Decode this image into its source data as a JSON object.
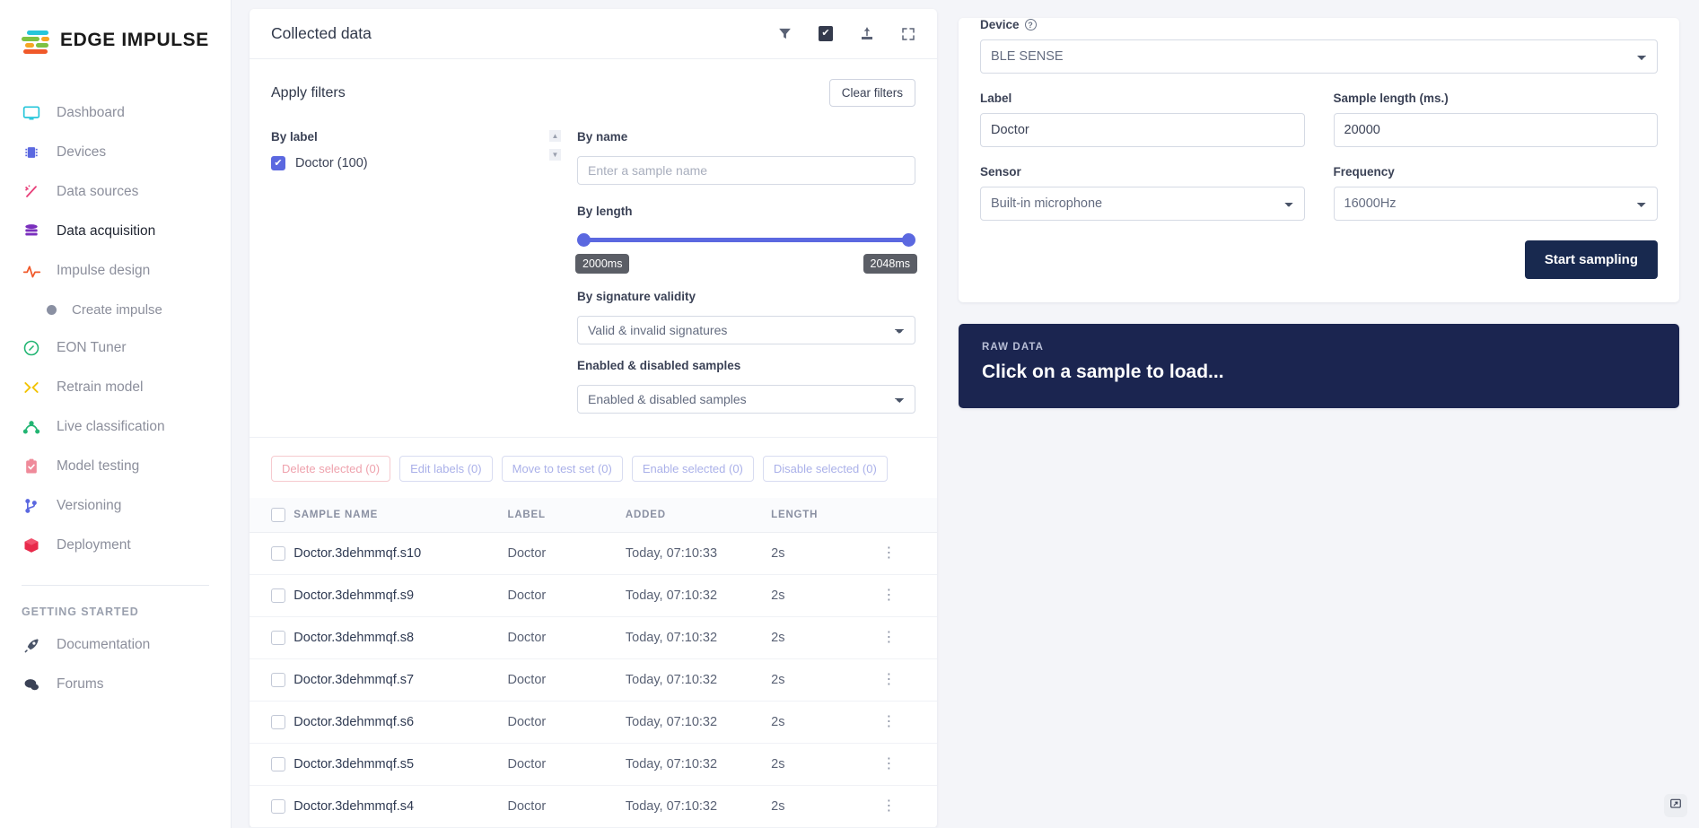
{
  "brand": {
    "name": "EDGE IMPULSE"
  },
  "sidebar": {
    "items": [
      {
        "label": "Dashboard",
        "icon": "monitor-icon"
      },
      {
        "label": "Devices",
        "icon": "chip-icon"
      },
      {
        "label": "Data sources",
        "icon": "wand-icon"
      },
      {
        "label": "Data acquisition",
        "icon": "database-icon"
      },
      {
        "label": "Impulse design",
        "icon": "pulse-icon"
      }
    ],
    "sub_item": {
      "label": "Create impulse",
      "icon": "dot-icon"
    },
    "items2": [
      {
        "label": "EON Tuner",
        "icon": "compass-icon"
      },
      {
        "label": "Retrain model",
        "icon": "shuffle-icon"
      },
      {
        "label": "Live classification",
        "icon": "graph-icon"
      },
      {
        "label": "Model testing",
        "icon": "clipboard-check-icon"
      },
      {
        "label": "Versioning",
        "icon": "branch-icon"
      },
      {
        "label": "Deployment",
        "icon": "box-icon"
      }
    ],
    "getting_started_header": "GETTING STARTED",
    "getting_started": [
      {
        "label": "Documentation",
        "icon": "rocket-icon"
      },
      {
        "label": "Forums",
        "icon": "chat-icon"
      }
    ]
  },
  "collected": {
    "title": "Collected data",
    "icons": [
      "filter-icon",
      "checkbox-checked-icon",
      "upload-icon",
      "expand-icon"
    ],
    "filters": {
      "title": "Apply filters",
      "clear_label": "Clear filters",
      "by_label_title": "By label",
      "label_option": "Doctor (100)",
      "label_checked": true,
      "by_name_title": "By name",
      "name_placeholder": "Enter a sample name",
      "name_value": "",
      "by_length_title": "By length",
      "length_min": "2000ms",
      "length_max": "2048ms",
      "signature_title": "By signature validity",
      "signature_value": "Valid & invalid signatures",
      "enabled_title": "Enabled & disabled samples",
      "enabled_value": "Enabled & disabled samples"
    },
    "actions": [
      {
        "label": "Delete selected (0)",
        "style": "danger"
      },
      {
        "label": "Edit labels (0)",
        "style": "normal"
      },
      {
        "label": "Move to test set (0)",
        "style": "normal"
      },
      {
        "label": "Enable selected (0)",
        "style": "normal"
      },
      {
        "label": "Disable selected (0)",
        "style": "normal"
      }
    ],
    "table": {
      "columns": [
        "SAMPLE NAME",
        "LABEL",
        "ADDED",
        "LENGTH"
      ],
      "rows": [
        {
          "name": "Doctor.3dehmmqf.s10",
          "label": "Doctor",
          "added": "Today, 07:10:33",
          "length": "2s"
        },
        {
          "name": "Doctor.3dehmmqf.s9",
          "label": "Doctor",
          "added": "Today, 07:10:32",
          "length": "2s"
        },
        {
          "name": "Doctor.3dehmmqf.s8",
          "label": "Doctor",
          "added": "Today, 07:10:32",
          "length": "2s"
        },
        {
          "name": "Doctor.3dehmmqf.s7",
          "label": "Doctor",
          "added": "Today, 07:10:32",
          "length": "2s"
        },
        {
          "name": "Doctor.3dehmmqf.s6",
          "label": "Doctor",
          "added": "Today, 07:10:32",
          "length": "2s"
        },
        {
          "name": "Doctor.3dehmmqf.s5",
          "label": "Doctor",
          "added": "Today, 07:10:32",
          "length": "2s"
        },
        {
          "name": "Doctor.3dehmmqf.s4",
          "label": "Doctor",
          "added": "Today, 07:10:32",
          "length": "2s"
        }
      ]
    }
  },
  "record": {
    "device_label": "Device",
    "device_value": "BLE SENSE",
    "label_label": "Label",
    "label_value": "Doctor",
    "sample_length_label": "Sample length (ms.)",
    "sample_length_value": "20000",
    "sensor_label": "Sensor",
    "sensor_value": "Built-in microphone",
    "frequency_label": "Frequency",
    "frequency_value": "16000Hz",
    "start_label": "Start sampling"
  },
  "raw": {
    "kicker": "RAW DATA",
    "title": "Click on a sample to load..."
  },
  "feedback": {
    "icon": "feedback-icon"
  },
  "colors": {
    "accent": "#5b68e0",
    "navy": "#18294f",
    "raw_bg": "#1b2550",
    "danger": "#e2566a"
  }
}
